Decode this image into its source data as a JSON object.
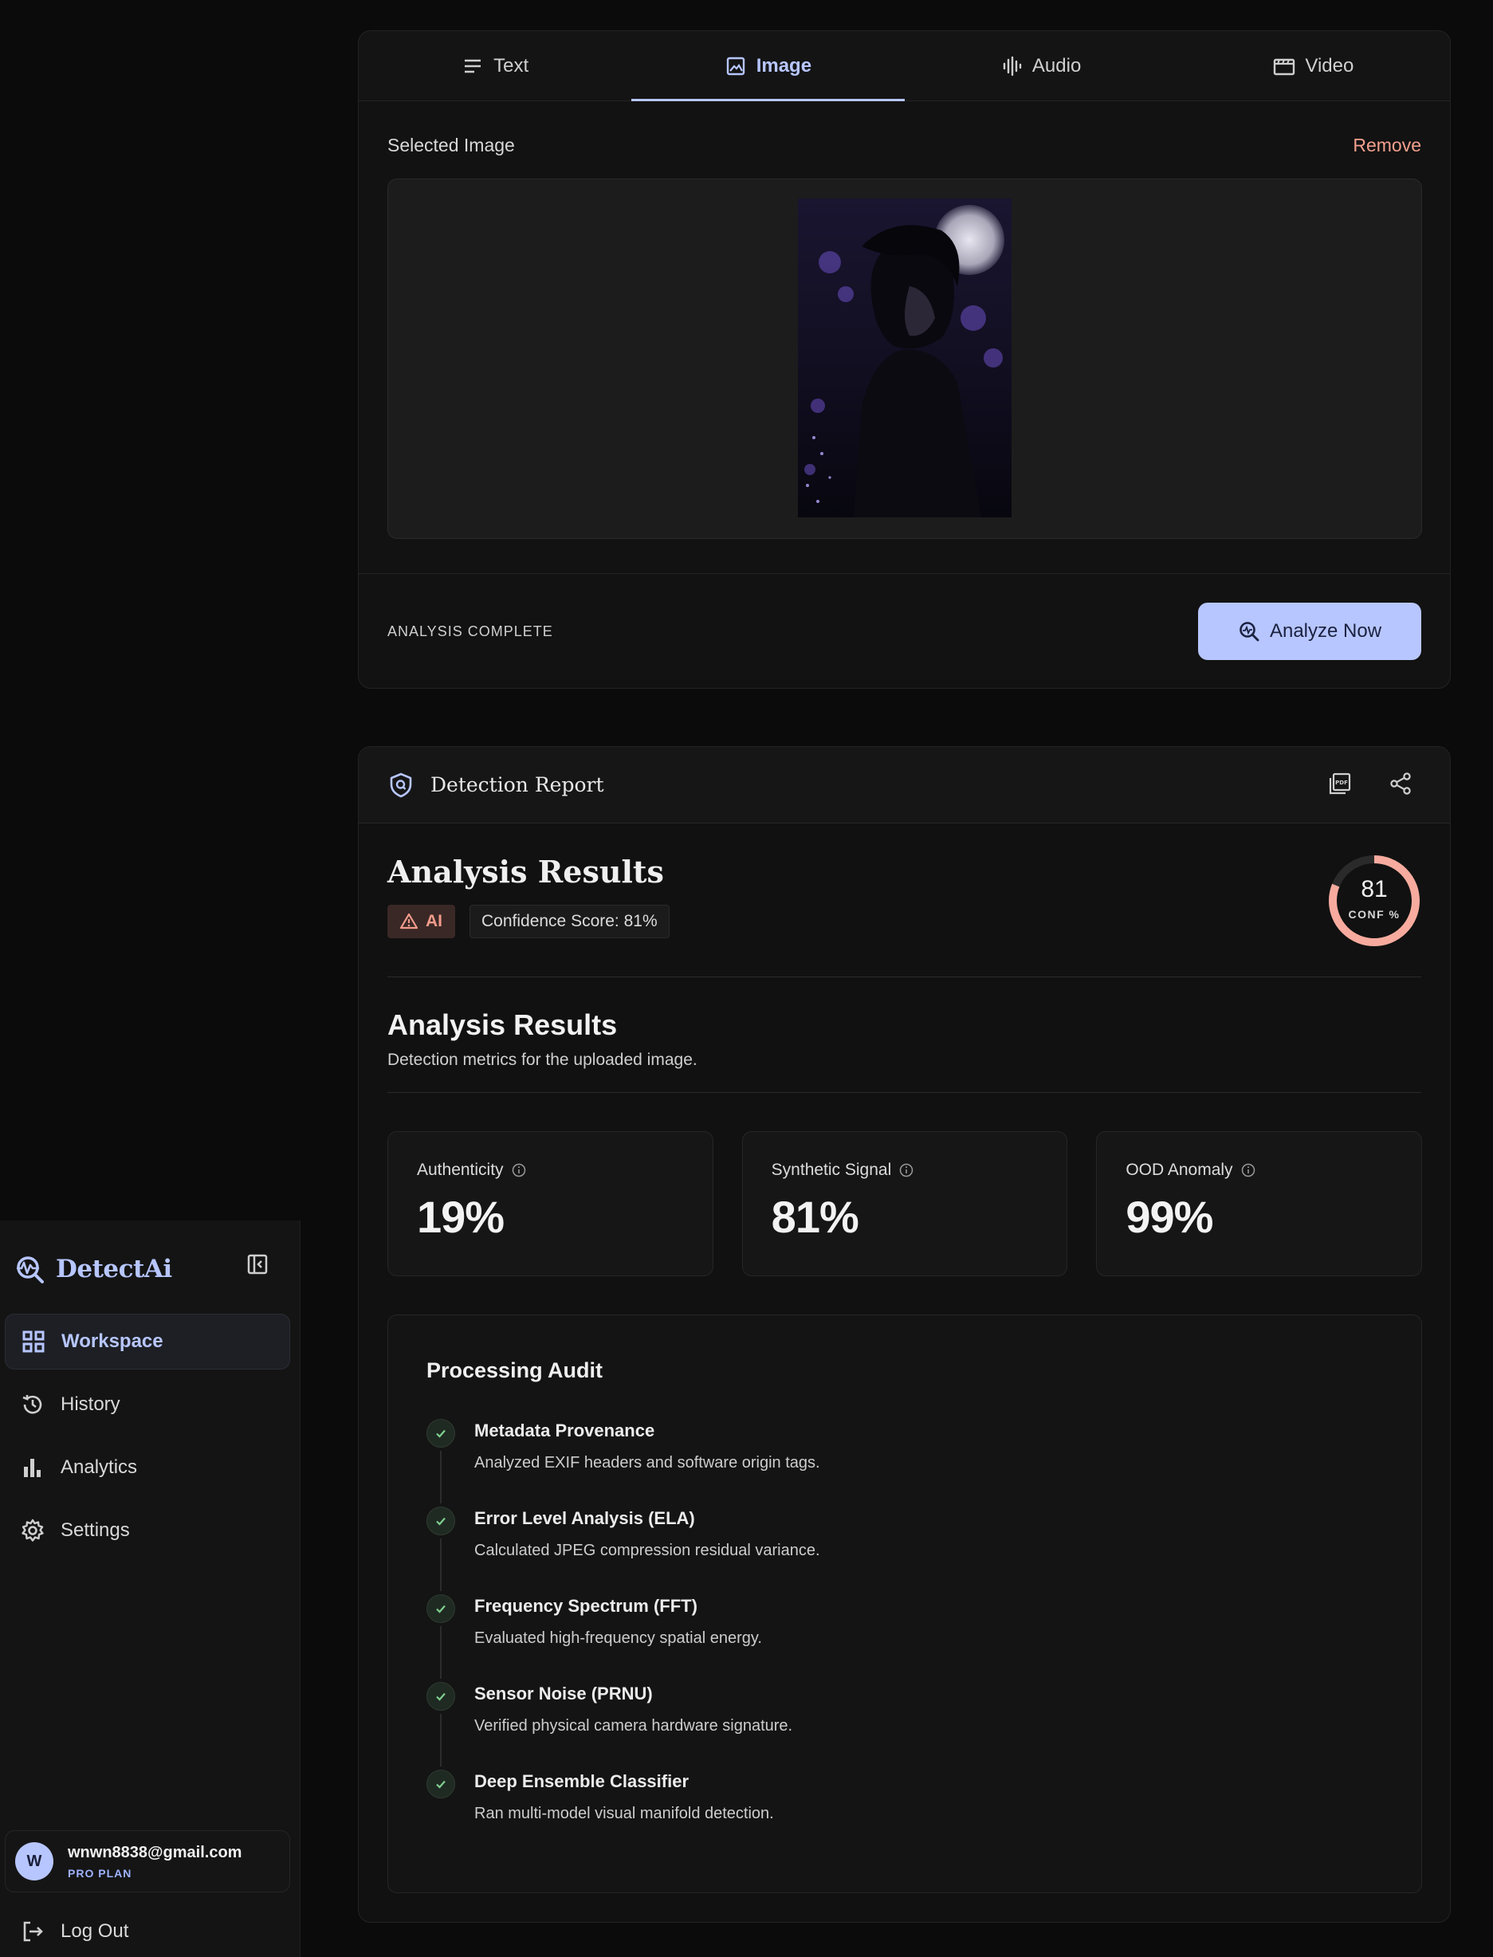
{
  "sidebar": {
    "brand": "DetectAi",
    "nav": [
      {
        "label": "Workspace",
        "icon": "grid-icon",
        "active": true
      },
      {
        "label": "History",
        "icon": "history-icon",
        "active": false
      },
      {
        "label": "Analytics",
        "icon": "bar-chart-icon",
        "active": false
      },
      {
        "label": "Settings",
        "icon": "gear-icon",
        "active": false
      }
    ],
    "user": {
      "initial": "W",
      "email": "wnwn8838@gmail.com",
      "plan": "PRO PLAN"
    },
    "logout": "Log Out"
  },
  "tabs": [
    {
      "label": "Text",
      "icon": "text-lines-icon"
    },
    {
      "label": "Image",
      "icon": "image-icon"
    },
    {
      "label": "Audio",
      "icon": "audio-wave-icon"
    },
    {
      "label": "Video",
      "icon": "clapperboard-icon"
    }
  ],
  "upload": {
    "selected_label": "Selected Image",
    "remove": "Remove",
    "status": "ANALYSIS COMPLETE",
    "analyze_button": "Analyze Now"
  },
  "report": {
    "header_title": "Detection Report",
    "title": "Analysis Results",
    "badge": "AI",
    "confidence_text": "Confidence Score: 81%",
    "gauge_value": "81",
    "gauge_label": "CONF %",
    "gauge_fraction": 0.81,
    "section_title": "Analysis Results",
    "section_subtitle": "Detection metrics for the uploaded image.",
    "metrics": [
      {
        "label": "Authenticity",
        "value": "19%"
      },
      {
        "label": "Synthetic Signal",
        "value": "81%"
      },
      {
        "label": "OOD Anomaly",
        "value": "99%"
      }
    ],
    "audit": {
      "title": "Processing Audit",
      "steps": [
        {
          "title": "Metadata Provenance",
          "desc": "Analyzed EXIF headers and software origin tags."
        },
        {
          "title": "Error Level Analysis (ELA)",
          "desc": "Calculated JPEG compression residual variance."
        },
        {
          "title": "Frequency Spectrum (FFT)",
          "desc": "Evaluated high-frequency spatial energy."
        },
        {
          "title": "Sensor Noise (PRNU)",
          "desc": "Verified physical camera hardware signature."
        },
        {
          "title": "Deep Ensemble Classifier",
          "desc": "Ran multi-model visual manifold detection."
        }
      ]
    }
  },
  "colors": {
    "accent": "#b7c6ff",
    "danger": "#f29b8b",
    "gauge_track": "#2a2a2a",
    "gauge_fill": "#f7ab9e",
    "success": "#7fcf8f"
  }
}
